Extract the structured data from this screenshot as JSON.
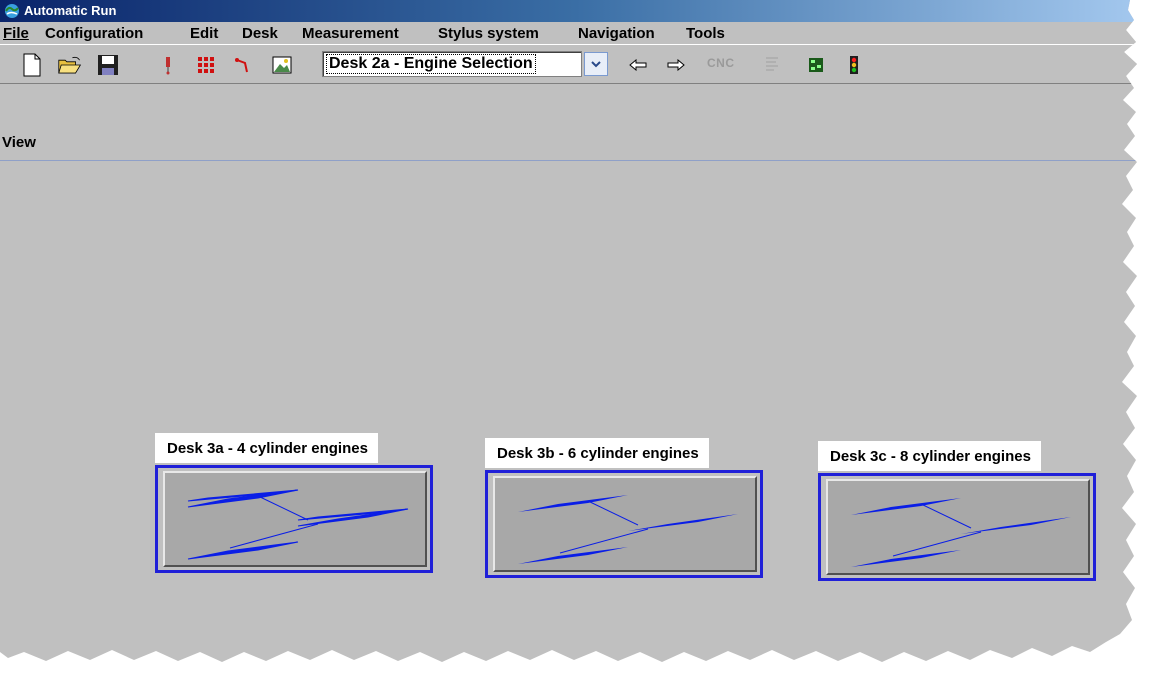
{
  "window": {
    "title": "Automatic Run",
    "icon": "app-icon"
  },
  "menu": [
    {
      "label": "File",
      "underline": "F"
    },
    {
      "label": "Configuration",
      "underline": "o"
    },
    {
      "label": "Edit",
      "underline": "E"
    },
    {
      "label": "Desk",
      "underline": "D"
    },
    {
      "label": "Measurement",
      "underline": "M"
    },
    {
      "label": "Stylus system",
      "underline": "S"
    },
    {
      "label": "Navigation",
      "underline": "N"
    },
    {
      "label": "Tools",
      "underline": "T"
    }
  ],
  "toolbar": {
    "new_icon": "new-document-icon",
    "open_icon": "open-folder-icon",
    "save_icon": "save-disk-icon",
    "desk_select": "Desk 2a - Engine Selection",
    "cnc_label": "CNC"
  },
  "view": {
    "label": "View"
  },
  "desks": [
    {
      "label": "Desk 3a - 4 cylinder engines"
    },
    {
      "label": "Desk 3b - 6 cylinder engines"
    },
    {
      "label": "Desk 3c - 8 cylinder engines"
    }
  ],
  "colors": {
    "window_bg": "#c0c0c0",
    "desk_border": "#2020d8",
    "desk_shape": "#0a1ee6"
  }
}
